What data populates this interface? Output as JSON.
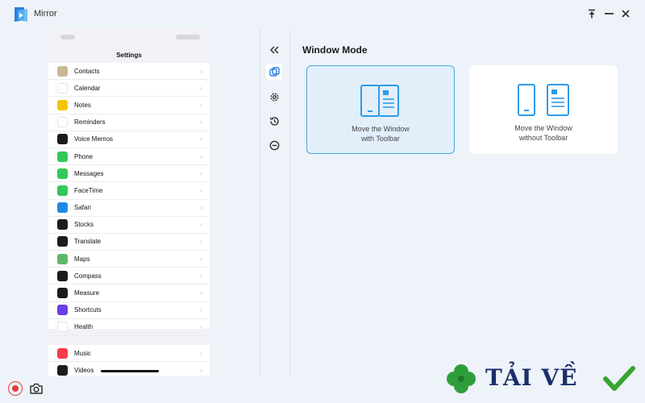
{
  "app": {
    "title": "Mirror",
    "logo_icon": "mirror-logo-icon"
  },
  "window_controls": {
    "pin": "pin-icon",
    "minimize": "minimize-icon",
    "close": "close-icon"
  },
  "phone": {
    "title": "Settings",
    "items": [
      {
        "label": "Contacts",
        "icon": "contacts-icon",
        "color": "#c9b895"
      },
      {
        "label": "Calendar",
        "icon": "calendar-icon",
        "color": "#ffffff"
      },
      {
        "label": "Notes",
        "icon": "notes-icon",
        "color": "#f5c400"
      },
      {
        "label": "Reminders",
        "icon": "reminders-icon",
        "color": "#ffffff"
      },
      {
        "label": "Voice Memos",
        "icon": "voice-memos-icon",
        "color": "#1c1c1e"
      },
      {
        "label": "Phone",
        "icon": "phone-icon",
        "color": "#34c759"
      },
      {
        "label": "Messages",
        "icon": "messages-icon",
        "color": "#34c759"
      },
      {
        "label": "FaceTime",
        "icon": "facetime-icon",
        "color": "#34c759"
      },
      {
        "label": "Safari",
        "icon": "safari-icon",
        "color": "#1e88e5"
      },
      {
        "label": "Stocks",
        "icon": "stocks-icon",
        "color": "#1c1c1e"
      },
      {
        "label": "Translate",
        "icon": "translate-icon",
        "color": "#1c1c1e"
      },
      {
        "label": "Maps",
        "icon": "maps-icon",
        "color": "#5fb86a"
      },
      {
        "label": "Compass",
        "icon": "compass-icon",
        "color": "#1c1c1e"
      },
      {
        "label": "Measure",
        "icon": "measure-icon",
        "color": "#1c1c1e"
      },
      {
        "label": "Shortcuts",
        "icon": "shortcuts-icon",
        "color": "#6a3de8"
      },
      {
        "label": "Health",
        "icon": "health-icon",
        "color": "#ffffff"
      }
    ],
    "items2": [
      {
        "label": "Music",
        "icon": "music-icon",
        "color": "#fa3c4c"
      },
      {
        "label": "Videos",
        "icon": "tv-icon",
        "color": "#1c1c1e"
      }
    ]
  },
  "toolbar": {
    "collapse": "double-chevron-left-icon",
    "window_mode": "window-mode-icon",
    "settings": "gear-icon",
    "history": "history-icon",
    "more": "more-icon"
  },
  "panel": {
    "title": "Window Mode",
    "cards": [
      {
        "line1": "Move the Window",
        "line2": "with Toolbar",
        "selected": true
      },
      {
        "line1": "Move the Window",
        "line2": "without Toolbar",
        "selected": false
      }
    ]
  },
  "bottom": {
    "record": "record-icon",
    "screenshot": "camera-icon"
  },
  "watermark": {
    "text": "TẢI VỀ",
    "leaf": "clover-icon",
    "check": "checkmark-icon"
  },
  "colors": {
    "accent": "#4aa7e6",
    "record": "#e83b3b",
    "background": "#eef3f9"
  }
}
